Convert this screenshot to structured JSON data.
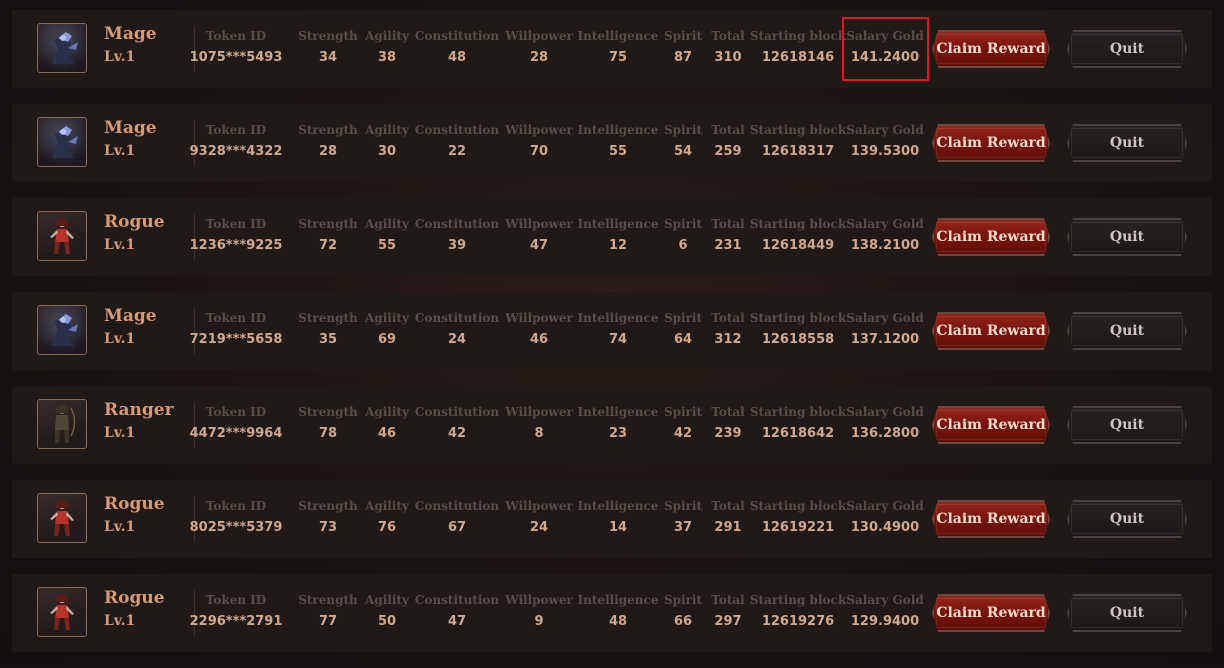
{
  "labels": {
    "token_id": "Token ID",
    "strength": "Strength",
    "agility": "Agility",
    "constitution": "Constitution",
    "willpower": "Willpower",
    "intelligence": "Intelligence",
    "spirit": "Spirit",
    "total": "Total",
    "starting_block": "Starting block",
    "salary_gold": "Salary Gold"
  },
  "buttons": {
    "claim": "Claim Reward",
    "quit": "Quit"
  },
  "colors": {
    "highlight_border": "#e8141a",
    "name_text": "#d89a72",
    "label_text": "#5a4d47",
    "value_text": "#d3a88a",
    "claim_button": "#7a140c",
    "quit_button": "#1f1b1a"
  },
  "highlighted_field": {
    "row": 0,
    "field": "salary_gold"
  },
  "heroes": [
    {
      "class": "Mage",
      "icon": "mage-portrait-icon",
      "level": "Lv.1",
      "token_id": "1075***5493",
      "strength": "34",
      "agility": "38",
      "constitution": "48",
      "willpower": "28",
      "intelligence": "75",
      "spirit": "87",
      "total": "310",
      "starting_block": "12618146",
      "salary_gold": "141.2400"
    },
    {
      "class": "Mage",
      "icon": "mage-portrait-icon",
      "level": "Lv.1",
      "token_id": "9328***4322",
      "strength": "28",
      "agility": "30",
      "constitution": "22",
      "willpower": "70",
      "intelligence": "55",
      "spirit": "54",
      "total": "259",
      "starting_block": "12618317",
      "salary_gold": "139.5300"
    },
    {
      "class": "Rogue",
      "icon": "rogue-portrait-icon",
      "level": "Lv.1",
      "token_id": "1236***9225",
      "strength": "72",
      "agility": "55",
      "constitution": "39",
      "willpower": "47",
      "intelligence": "12",
      "spirit": "6",
      "total": "231",
      "starting_block": "12618449",
      "salary_gold": "138.2100"
    },
    {
      "class": "Mage",
      "icon": "mage-portrait-icon",
      "level": "Lv.1",
      "token_id": "7219***5658",
      "strength": "35",
      "agility": "69",
      "constitution": "24",
      "willpower": "46",
      "intelligence": "74",
      "spirit": "64",
      "total": "312",
      "starting_block": "12618558",
      "salary_gold": "137.1200"
    },
    {
      "class": "Ranger",
      "icon": "ranger-portrait-icon",
      "level": "Lv.1",
      "token_id": "4472***9964",
      "strength": "78",
      "agility": "46",
      "constitution": "42",
      "willpower": "8",
      "intelligence": "23",
      "spirit": "42",
      "total": "239",
      "starting_block": "12618642",
      "salary_gold": "136.2800"
    },
    {
      "class": "Rogue",
      "icon": "rogue-portrait-icon",
      "level": "Lv.1",
      "token_id": "8025***5379",
      "strength": "73",
      "agility": "76",
      "constitution": "67",
      "willpower": "24",
      "intelligence": "14",
      "spirit": "37",
      "total": "291",
      "starting_block": "12619221",
      "salary_gold": "130.4900"
    },
    {
      "class": "Rogue",
      "icon": "rogue-portrait-icon",
      "level": "Lv.1",
      "token_id": "2296***2791",
      "strength": "77",
      "agility": "50",
      "constitution": "47",
      "willpower": "9",
      "intelligence": "48",
      "spirit": "66",
      "total": "297",
      "starting_block": "12619276",
      "salary_gold": "129.9400"
    }
  ]
}
